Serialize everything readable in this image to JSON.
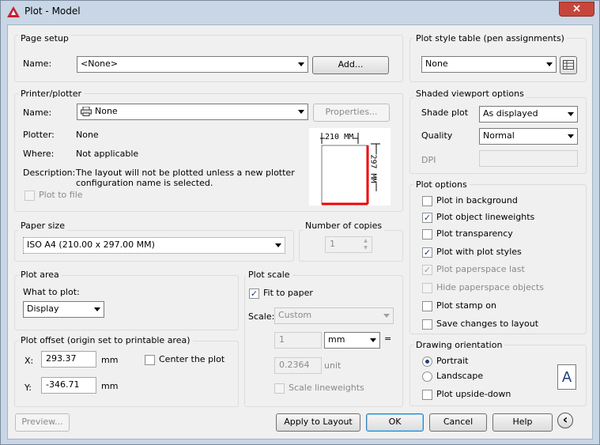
{
  "window": {
    "title": "Plot - Model",
    "close_icon": "×"
  },
  "page_setup": {
    "group": "Page setup",
    "name_label": "Name:",
    "name_value": "<None>",
    "add_button": "Add..."
  },
  "printer": {
    "group": "Printer/plotter",
    "name_label": "Name:",
    "name_value": "None",
    "properties_button": "Properties...",
    "plotter_label": "Plotter:",
    "plotter_value": "None",
    "where_label": "Where:",
    "where_value": "Not applicable",
    "description_label": "Description:",
    "description_line1": "The layout will not be plotted unless a new plotter",
    "description_line2": "configuration name is selected.",
    "plot_to_file": "Plot to file",
    "preview_width": "210 MM",
    "preview_height": "297 MM"
  },
  "paper_size": {
    "group": "Paper size",
    "value": "ISO A4 (210.00 x 297.00 MM)"
  },
  "copies": {
    "group": "Number of copies",
    "value": "1"
  },
  "plot_area": {
    "group": "Plot area",
    "what_label": "What to plot:",
    "what_value": "Display"
  },
  "plot_offset": {
    "group": "Plot offset (origin set to printable area)",
    "x_label": "X:",
    "x_value": "293.37",
    "x_unit": "mm",
    "y_label": "Y:",
    "y_value": "-346.71",
    "y_unit": "mm",
    "center_label": "Center the plot"
  },
  "plot_scale": {
    "group": "Plot scale",
    "fit_label": "Fit to paper",
    "fit_checked": "✓",
    "scale_label": "Scale:",
    "scale_value": "Custom",
    "value1": "1",
    "unit_value": "mm",
    "equals": "=",
    "value2": "0.2364",
    "unit_label": "unit",
    "lineweights_label": "Scale lineweights"
  },
  "plot_style": {
    "group": "Plot style table (pen assignments)",
    "value": "None"
  },
  "shaded": {
    "group": "Shaded viewport options",
    "shade_label": "Shade plot",
    "shade_value": "As displayed",
    "quality_label": "Quality",
    "quality_value": "Normal",
    "dpi_label": "DPI"
  },
  "options": {
    "group": "Plot options",
    "items": [
      {
        "label": "Plot in background",
        "mark": ""
      },
      {
        "label": "Plot object lineweights",
        "mark": "✓"
      },
      {
        "label": "Plot transparency",
        "mark": ""
      },
      {
        "label": "Plot with plot styles",
        "mark": "✓"
      },
      {
        "label": "Plot paperspace last",
        "mark": "✓"
      },
      {
        "label": "Hide paperspace objects",
        "mark": ""
      },
      {
        "label": "Plot stamp on",
        "mark": ""
      },
      {
        "label": "Save changes to layout",
        "mark": ""
      }
    ]
  },
  "orientation": {
    "group": "Drawing orientation",
    "portrait": "Portrait",
    "landscape": "Landscape",
    "upside_down": "Plot upside-down",
    "icon_letter": "A"
  },
  "footer": {
    "preview": "Preview...",
    "apply": "Apply to Layout",
    "ok": "OK",
    "cancel": "Cancel",
    "help": "Help",
    "more_icon": "‹"
  }
}
